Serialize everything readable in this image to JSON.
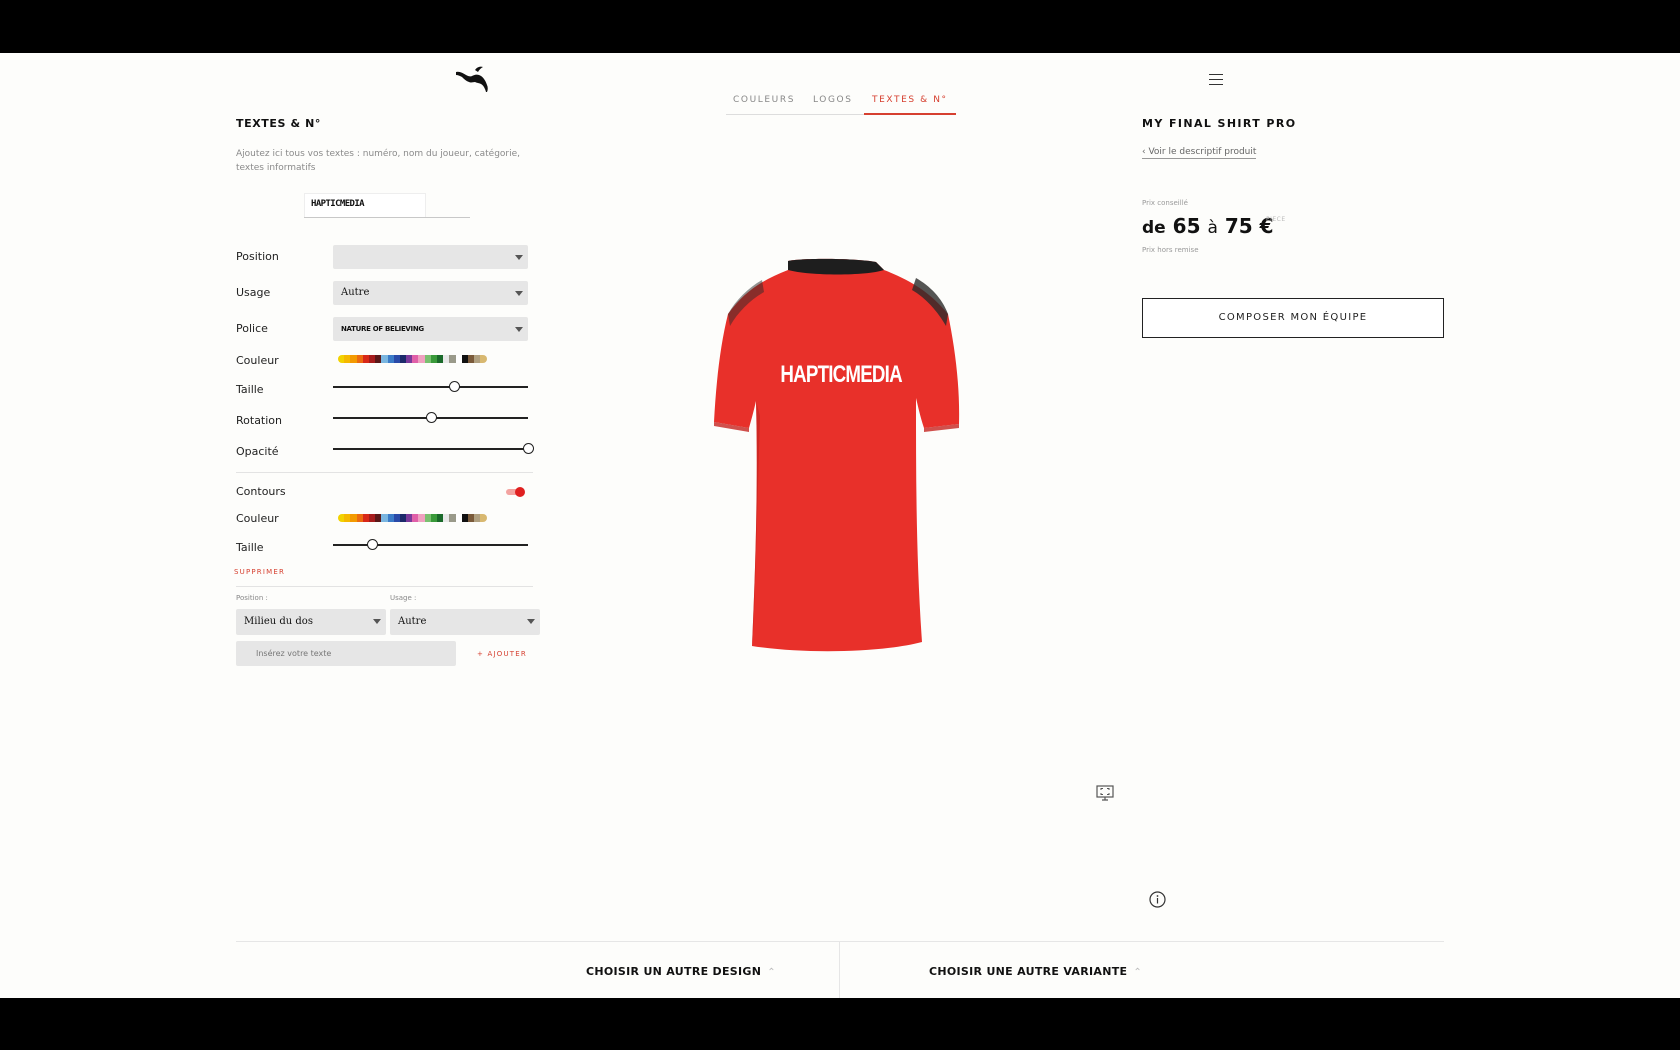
{
  "header": {
    "tabs": [
      {
        "label": "COULEURS",
        "active": false
      },
      {
        "label": "LOGOS",
        "active": false
      },
      {
        "label": "TEXTES & N°",
        "active": true
      }
    ]
  },
  "left_panel": {
    "title": "TEXTES & N°",
    "description": "Ajoutez ici tous vos textes : numéro, nom du joueur, catégorie, textes informatifs",
    "text_chip": "HAPTICMEDIA",
    "fields": {
      "position_label": "Position",
      "position_value": "",
      "usage_label": "Usage",
      "usage_value": "Autre",
      "police_label": "Police",
      "police_value": "NATURE OF BELIEVING",
      "couleur_label": "Couleur",
      "taille_label": "Taille",
      "taille_value": 0.62,
      "rotation_label": "Rotation",
      "rotation_value": 0.5,
      "opacite_label": "Opacité",
      "opacite_value": 1.0,
      "contours_label": "Contours",
      "contours_enabled": true,
      "contour_couleur_label": "Couleur",
      "contour_taille_label": "Taille",
      "contour_taille_value": 0.2
    },
    "swatch_colors": [
      "#f2d200",
      "#f5b800",
      "#f39a00",
      "#ec6a10",
      "#d82818",
      "#a61c1c",
      "#5a1818",
      "#7ab6e0",
      "#3c7cc8",
      "#2a4aa8",
      "#1c2a6a",
      "#7a3a9a",
      "#e060a8",
      "#f0a0c0",
      "#7ac070",
      "#3a9a3a",
      "#1a6a2a",
      "#e8e8e8",
      "#9a9a8a",
      "#ffffff",
      "#111111",
      "#7a5a3a",
      "#b0a080",
      "#d8b870"
    ],
    "delete_label": "SUPPRIMER",
    "new_text": {
      "position_label": "Position :",
      "position_value": "Milieu du dos",
      "usage_label": "Usage :",
      "usage_value": "Autre",
      "input_placeholder": "Insérez votre texte",
      "add_label": "+ AJOUTER"
    }
  },
  "preview": {
    "shirt_text": "HAPTICMEDIA",
    "shirt_color": "#e8302a",
    "collar_color": "#1e1e1e"
  },
  "right_panel": {
    "product_title": "MY FINAL SHIRT PRO",
    "product_link": "Voir le descriptif produit",
    "price_caption": "Prix conseillé",
    "price_prefix": "de",
    "price_min": "65",
    "price_sep": "à",
    "price_max": "75 €",
    "price_unit": "PIECE",
    "price_note": "Prix hors remise",
    "compose_button": "COMPOSER MON ÉQUIPE"
  },
  "footer": {
    "design_button": "CHOISIR UN AUTRE DESIGN",
    "variant_button": "CHOISIR UNE AUTRE VARIANTE"
  },
  "colors": {
    "accent": "#d64030",
    "toggle_on": "#e02020"
  }
}
